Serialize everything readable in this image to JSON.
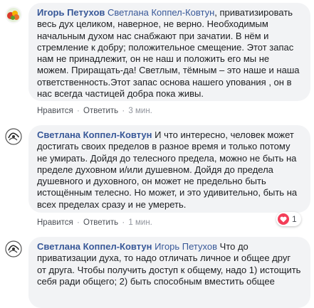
{
  "comments": [
    {
      "author": "Игорь Петухов",
      "mention": "Светлана Коппел-Ковтун",
      "text": ", приватизировать весь дух целиком, наверное, не верно. Необходимым начальным духом нас снабжают при зачатии. В нём и стремление к добру; положительное смещение. Этот запас нам не принадлежит, он не наш и положить его мы не можем. Приращать-да! Светлым, тёмным – это наше и наша ответственность.Этот запас основа нашего упования , он в нас всегда частицей добра пока живы.",
      "like_label": "Нравится",
      "reply_label": "Ответить",
      "time": "3 мин."
    },
    {
      "author": "Светлана Коппел-Ковтун",
      "mention": "",
      "text": "И что интересно, человек может достигать своих пределов в разное время и только потому не умирать. Дойдя до телесного предела, можно не быть на пределе духовном и/или душевном. Дойдя до предела душевного и духовного, он может не предельно быть истощённым телесно. Но может, и это удивительно, быть на всех пределах сразу и не умереть.",
      "like_label": "Нравится",
      "reply_label": "Ответить",
      "time": "1 мин.",
      "reaction_count": "1"
    },
    {
      "author": "Светлана Коппел-Ковтун",
      "mention": "Игорь Петухов",
      "text": "Что до приватизации духа, то надо отличать личное и общее друг от друга. Чтобы получить доступ к общему, надо 1) истощить себя ради общего; 2) быть способным вместить общее"
    }
  ],
  "separator": "·",
  "colors": {
    "link": "#385898",
    "bubble": "#f2f3f5",
    "meta": "#90949c",
    "heart": "#f33e58"
  }
}
